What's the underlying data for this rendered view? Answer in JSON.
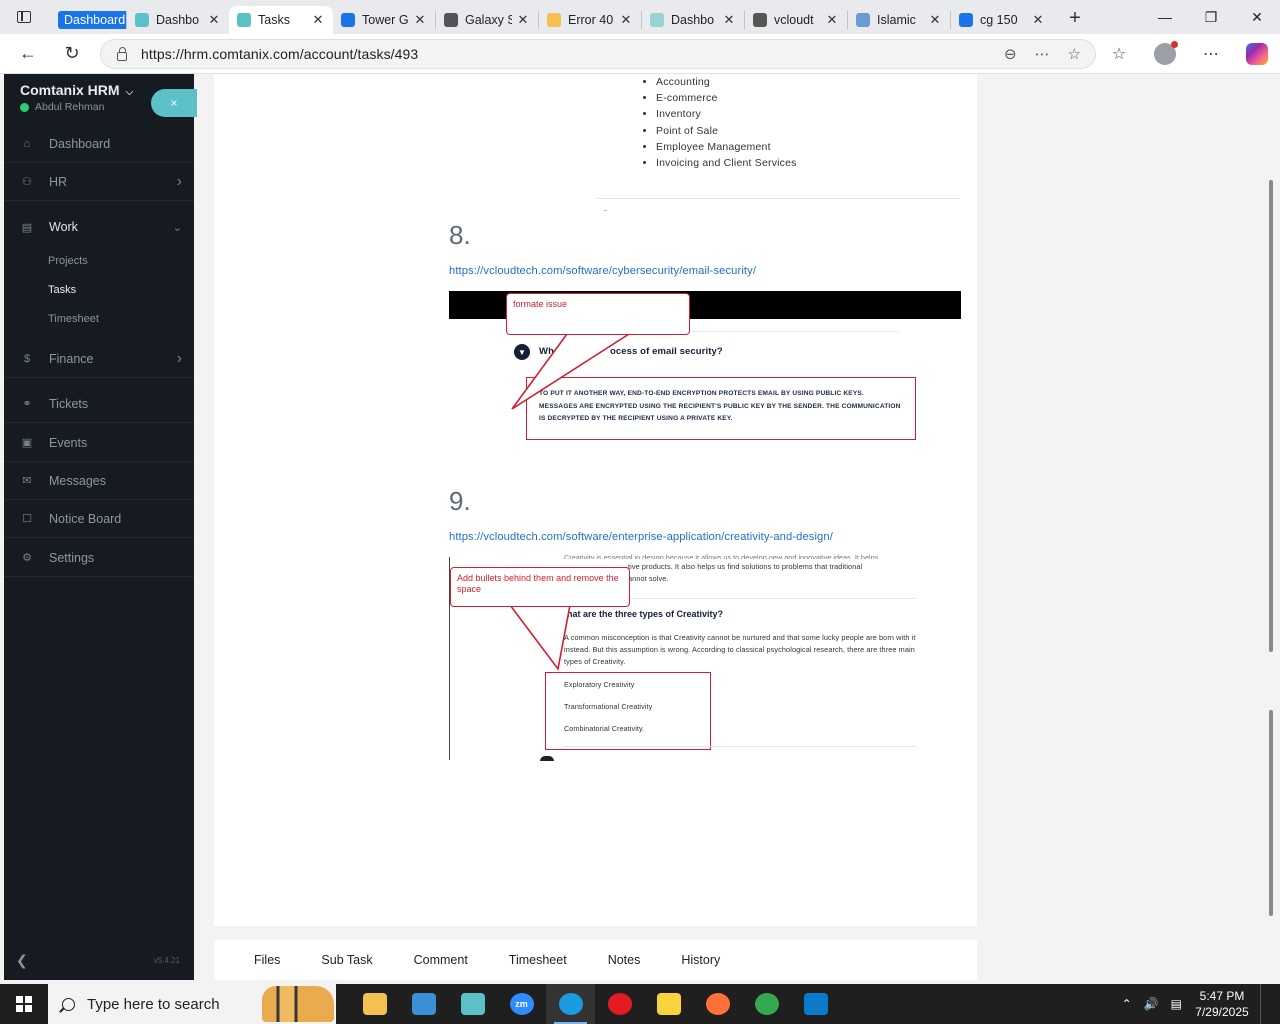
{
  "browser": {
    "tabs": [
      {
        "label": "Dashboard",
        "favicon_color": "#1a73e8",
        "style": "highlight"
      },
      {
        "label": "Dashbo",
        "favicon_color": "#5bc0c8"
      },
      {
        "label": "Tasks",
        "favicon_color": "#5bc0c8",
        "active": true
      },
      {
        "label": "Tower G",
        "favicon_color": "#1a73e8"
      },
      {
        "label": "Galaxy S",
        "favicon_color": "#555555"
      },
      {
        "label": "Error 40",
        "favicon_color": "#f2c14e"
      },
      {
        "label": "Dashbo",
        "favicon_color": "#9ad1d4"
      },
      {
        "label": "vcloudt",
        "favicon_color": "#555555"
      },
      {
        "label": "Islamic",
        "favicon_color": "#6c9bd2"
      },
      {
        "label": "cg 150",
        "favicon_color": "#1a73e8"
      }
    ],
    "url": "https://hrm.comtanix.com/account/tasks/493"
  },
  "sidebar": {
    "brand": "Comtanix HRM",
    "user": "Abdul Rehman",
    "close_symbol": "×",
    "items": [
      {
        "label": "Dashboard",
        "icon": "home-icon"
      },
      {
        "label": "HR",
        "icon": "users-icon",
        "chevron": "right"
      },
      {
        "label": "Work",
        "icon": "briefcase-icon",
        "chevron": "down",
        "open": true
      },
      {
        "label": "Finance",
        "icon": "dollar-icon",
        "chevron": "right"
      },
      {
        "label": "Tickets",
        "icon": "headset-icon"
      },
      {
        "label": "Events",
        "icon": "calendar-icon"
      },
      {
        "label": "Messages",
        "icon": "message-icon"
      },
      {
        "label": "Notice Board",
        "icon": "clipboard-icon"
      },
      {
        "label": "Settings",
        "icon": "gear-icon"
      }
    ],
    "work_submenu": [
      "Projects",
      "Tasks",
      "Timesheet"
    ],
    "active_submenu": "Tasks",
    "version": "v5.4.21"
  },
  "content": {
    "list_items": [
      "Accounting",
      "E-commerce",
      "Inventory",
      "Point of Sale",
      "Employee Management",
      "Invoicing and Client Services"
    ],
    "section8": {
      "number": "8.",
      "link": "https://vcloudtech.com/software/cybersecurity/email-security/",
      "callout": "formate issue",
      "faq_question_start": "Wh",
      "faq_question_end": "ocess of email security?",
      "answer": "TO PUT IT ANOTHER WAY, END-TO-END ENCRYPTION PROTECTS EMAIL BY USING PUBLIC KEYS. MESSAGES ARE ENCRYPTED USING THE RECIPIENT'S PUBLIC KEY BY THE SENDER. THE COMMUNICATION IS DECRYPTED BY THE RECIPIENT USING A PRIVATE KEY."
    },
    "section9": {
      "number": "9.",
      "link": "https://vcloudtech.com/software/enterprise-application/creativity-and-design/",
      "callout": "Add bullets behind them and remove the space",
      "top_text_1": "tive products. It also helps us find solutions to problems that traditional",
      "top_text_2": "annot solve.",
      "question": "hat are the three types of Creativity?",
      "paragraph": "A common misconception is that Creativity cannot be nurtured and that some lucky people are born with it instead. But this assumption is wrong. According to classical psychological research, there are three main types of Creativity.",
      "types": [
        "Exploratory Creativity",
        "Transformational Creativity",
        "Combinatorial Creativity."
      ]
    }
  },
  "bottom_tabs": [
    "Files",
    "Sub Task",
    "Comment",
    "Timesheet",
    "Notes",
    "History"
  ],
  "taskbar": {
    "search_placeholder": "Type here to search",
    "time": "5:47 PM",
    "date": "7/29/2025",
    "apps": [
      {
        "name": "file-explorer",
        "color": "#f2c14e"
      },
      {
        "name": "app-2",
        "color": "#3a8fd6"
      },
      {
        "name": "app-3",
        "color": "#5bc0c8"
      },
      {
        "name": "zoom",
        "color": "#2d8cff",
        "text": "zm"
      },
      {
        "name": "edge",
        "color": "#1a9be0",
        "active": true
      },
      {
        "name": "opera",
        "color": "#e31b23"
      },
      {
        "name": "sticky-notes",
        "color": "#f9d33d"
      },
      {
        "name": "firefox",
        "color": "#ff7139"
      },
      {
        "name": "chrome",
        "color": "#34a853"
      },
      {
        "name": "vscode",
        "color": "#0a7acc"
      }
    ]
  }
}
